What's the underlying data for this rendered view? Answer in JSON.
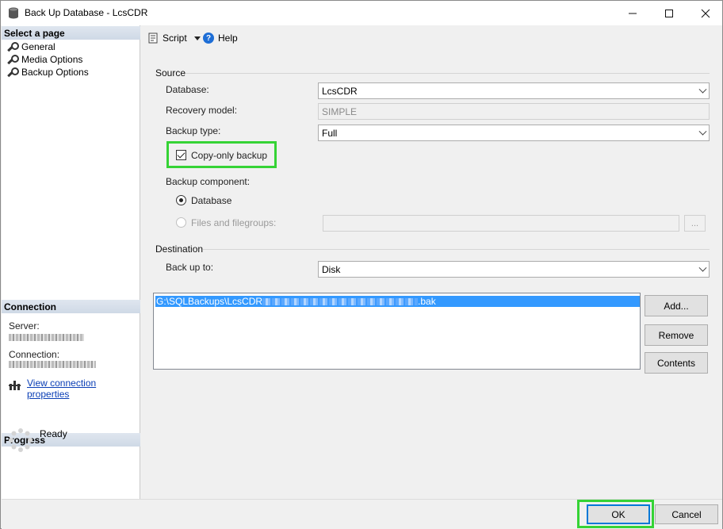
{
  "window": {
    "title": "Back Up Database - LcsCDR"
  },
  "left_pane": {
    "select_page_header": "Select a page",
    "pages": [
      "General",
      "Media Options",
      "Backup Options"
    ],
    "connection_header": "Connection",
    "server_label": "Server:",
    "connection_label": "Connection:",
    "view_connection_properties": "View connection properties",
    "progress_header": "Progress",
    "progress_status": "Ready"
  },
  "toolbar": {
    "script_label": "Script",
    "help_label": "Help"
  },
  "source": {
    "group_label": "Source",
    "database_label": "Database:",
    "database_value": "LcsCDR",
    "recovery_model_label": "Recovery model:",
    "recovery_model_value": "SIMPLE",
    "backup_type_label": "Backup type:",
    "backup_type_value": "Full",
    "copy_only_label": "Copy-only backup",
    "copy_only_checked": true,
    "backup_component_label": "Backup component:",
    "component_database_label": "Database",
    "component_files_label": "Files and filegroups:",
    "browse_button_label": "..."
  },
  "destination": {
    "group_label": "Destination",
    "back_up_to_label": "Back up to:",
    "back_up_to_value": "Disk",
    "paths": [
      {
        "prefix": "G:\\SQLBackups\\LcsCDR",
        "suffix": ".bak"
      }
    ],
    "add_button": "Add...",
    "remove_button": "Remove",
    "contents_button": "Contents"
  },
  "footer": {
    "ok_button": "OK",
    "cancel_button": "Cancel"
  },
  "colors": {
    "highlight": "#35d335",
    "selection": "#3399ff",
    "link": "#0a3eb5"
  }
}
